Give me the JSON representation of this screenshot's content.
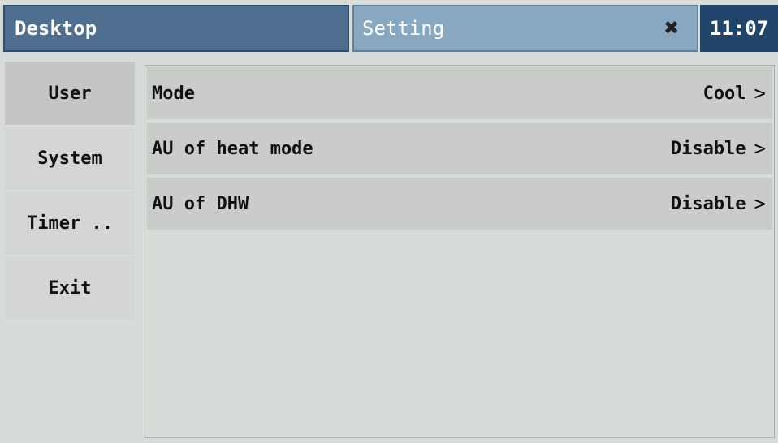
{
  "header": {
    "desktop_label": "Desktop",
    "setting_label": "Setting",
    "close_icon": "close-icon",
    "time": "11:07"
  },
  "sidebar": {
    "items": [
      {
        "label": "User",
        "active": true
      },
      {
        "label": "System",
        "active": false
      },
      {
        "label": "Timer ..",
        "active": false
      },
      {
        "label": "Exit",
        "active": false
      }
    ]
  },
  "settings": {
    "rows": [
      {
        "label": "Mode",
        "value": "Cool"
      },
      {
        "label": "AU of heat mode",
        "value": "Disable"
      },
      {
        "label": "AU of  DHW",
        "value": "Disable"
      }
    ]
  },
  "colors": {
    "title_bar": "#4e6f90",
    "active_tab": "#88a8c2",
    "clock_bg": "#21456a",
    "background": "#d8dcd8"
  }
}
